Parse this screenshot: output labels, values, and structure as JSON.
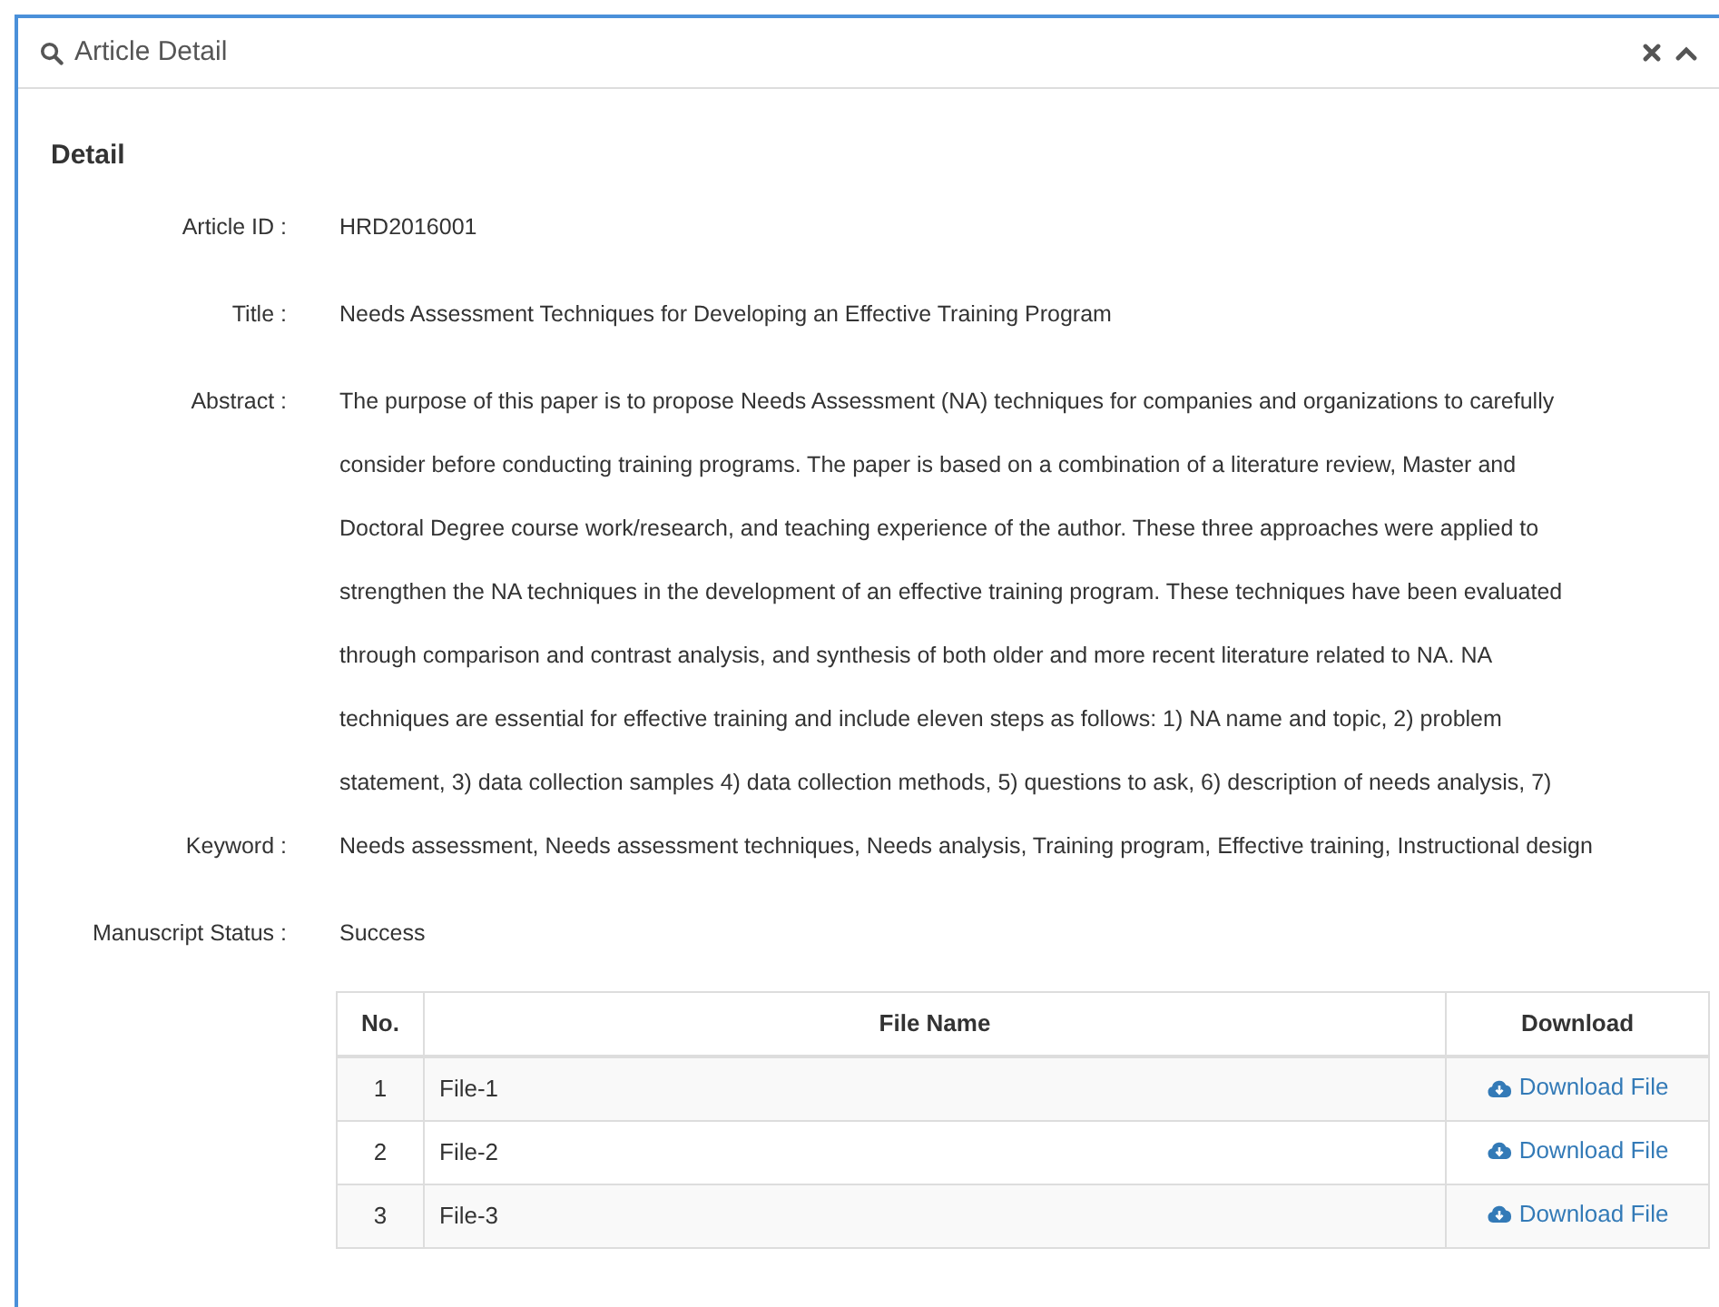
{
  "panel": {
    "title": "Article Detail"
  },
  "section_title": "Detail",
  "fields": [
    {
      "kind": "text",
      "label": "Article ID :",
      "value": "HRD2016001"
    },
    {
      "kind": "text",
      "label": "Title :",
      "value": "Needs Assessment Techniques for Developing an Effective Training Program"
    },
    {
      "kind": "lines",
      "label": "Abstract :",
      "lines": [
        "The purpose of this paper is to propose Needs Assessment (NA) techniques for companies and organizations to carefully",
        "consider before conducting training programs. The paper is based on a combination of a literature review, Master and",
        "Doctoral Degree course work/research, and teaching experience of the author. These three approaches were applied to",
        "strengthen the NA techniques in the development of an effective training program. These techniques have been evaluated",
        "through comparison and contrast analysis, and synthesis of both older and more recent literature related to NA. NA",
        "techniques are essential for effective training and include eleven steps as follows: 1) NA name and topic, 2) problem",
        "statement, 3) data collection samples 4) data collection methods, 5) questions to ask, 6) description of needs analysis, 7)"
      ]
    },
    {
      "kind": "text",
      "label": "Keyword :",
      "value": "Needs assessment, Needs assessment techniques, Needs analysis, Training program, Effective training, Instructional design"
    },
    {
      "kind": "text",
      "label": "Manuscript Status :",
      "value": "Success"
    }
  ],
  "table": {
    "columns": [
      "No.",
      "File Name",
      "Download"
    ],
    "rows": [
      {
        "no": "1",
        "file_name": "File-1",
        "download": "Download File"
      },
      {
        "no": "2",
        "file_name": "File-2",
        "download": "Download File"
      },
      {
        "no": "3",
        "file_name": "File-3",
        "download": "Download File"
      }
    ]
  }
}
